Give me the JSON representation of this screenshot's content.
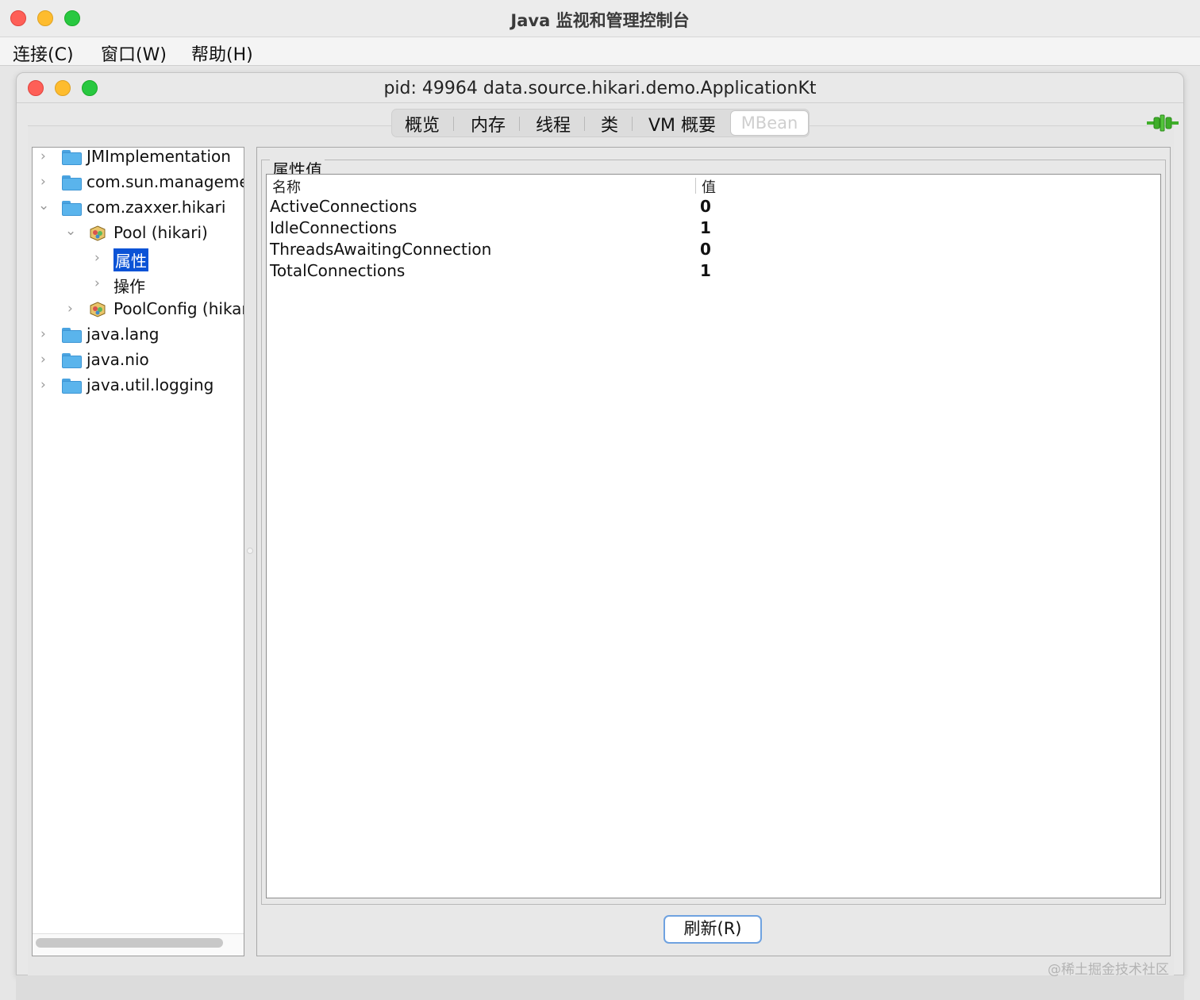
{
  "app": {
    "title": "Java 监视和管理控制台"
  },
  "menu": {
    "items": [
      "连接(C)",
      "窗口(W)",
      "帮助(H)"
    ]
  },
  "window": {
    "title": "pid: 49964 data.source.hikari.demo.ApplicationKt"
  },
  "tabs": {
    "items": [
      "概览",
      "内存",
      "线程",
      "类",
      "VM 概要"
    ],
    "active": "MBean"
  },
  "tree": {
    "items": [
      {
        "label": "JMImplementation",
        "icon": "folder-icon",
        "expanded": false
      },
      {
        "label": "com.sun.manageme",
        "icon": "folder-icon",
        "expanded": false
      },
      {
        "label": "com.zaxxer.hikari",
        "icon": "folder-icon",
        "expanded": true
      },
      {
        "label": "Pool (hikari)",
        "icon": "bean-icon",
        "expanded": true
      },
      {
        "label": "属性",
        "icon": "",
        "expanded": false,
        "selected": true
      },
      {
        "label": "操作",
        "icon": "",
        "expanded": false
      },
      {
        "label": "PoolConfig (hikar",
        "icon": "bean-icon",
        "expanded": false
      },
      {
        "label": "java.lang",
        "icon": "folder-icon",
        "expanded": false
      },
      {
        "label": "java.nio",
        "icon": "folder-icon",
        "expanded": false
      },
      {
        "label": "java.util.logging",
        "icon": "folder-icon",
        "expanded": false
      }
    ]
  },
  "attributes": {
    "group_title": "属性值",
    "columns": [
      "名称",
      "值"
    ],
    "rows": [
      {
        "name": "ActiveConnections",
        "value": "0"
      },
      {
        "name": "IdleConnections",
        "value": "1"
      },
      {
        "name": "ThreadsAwaitingConnection",
        "value": "0"
      },
      {
        "name": "TotalConnections",
        "value": "1"
      }
    ],
    "refresh_label": "刷新(R)"
  },
  "watermark": "@稀土掘金技术社区",
  "colors": {
    "selection": "#0b53d6",
    "folder": "#5ab4ec",
    "connected": "#3fae2a",
    "close": "#fe5f57",
    "minimize": "#febc2e",
    "zoom": "#28c840"
  }
}
